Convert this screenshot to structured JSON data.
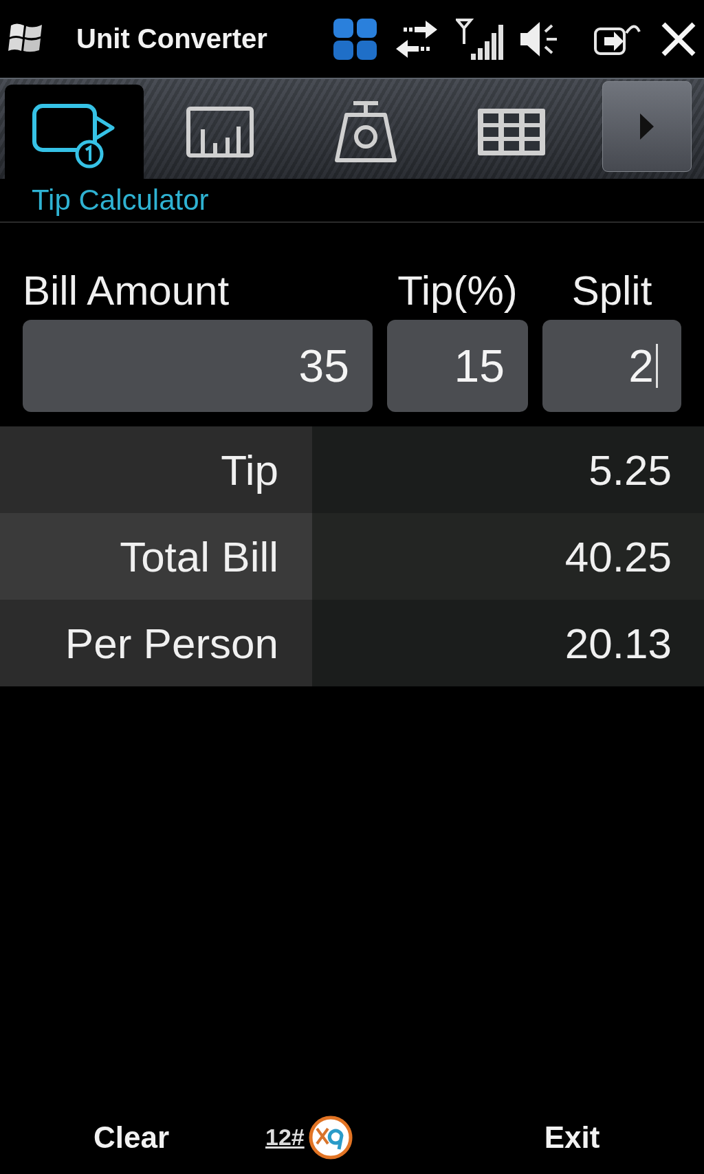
{
  "title_bar": {
    "title": "Unit Converter"
  },
  "tabs": [
    {
      "kind": "tip",
      "selected": true
    },
    {
      "kind": "chart",
      "selected": false
    },
    {
      "kind": "scale",
      "selected": false
    },
    {
      "kind": "grid",
      "selected": false
    }
  ],
  "section_title": "Tip Calculator",
  "inputs": [
    {
      "label": "Bill Amount",
      "value": "35",
      "focused": false
    },
    {
      "label": "Tip(%)",
      "value": "15",
      "focused": false
    },
    {
      "label": "Split",
      "value": "2",
      "focused": true
    }
  ],
  "results": [
    {
      "label": "Tip",
      "value": "5.25"
    },
    {
      "label": "Total Bill",
      "value": "40.25"
    },
    {
      "label": "Per Person",
      "value": "20.13"
    }
  ],
  "soft_keys": {
    "left": "Clear",
    "input_mode": "12#",
    "right": "Exit"
  }
}
